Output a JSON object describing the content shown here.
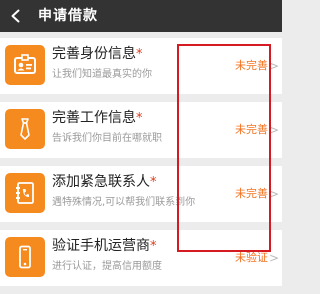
{
  "header": {
    "title": "申请借款",
    "back_icon": "chevron-left-icon"
  },
  "items": [
    {
      "label": "完善身份信息",
      "required_mark": "*",
      "subtitle": "让我们知道最真实的你",
      "status": "未完善",
      "icon": "id-card-icon"
    },
    {
      "label": "完善工作信息",
      "required_mark": "*",
      "subtitle": "告诉我们你目前在哪就职",
      "status": "未完善",
      "icon": "necktie-icon"
    },
    {
      "label": "添加紧急联系人",
      "required_mark": "*",
      "subtitle": "遇特殊情况,可以帮我们联系到你",
      "status": "未完善",
      "icon": "contact-book-icon"
    },
    {
      "label": "验证手机运营商",
      "required_mark": "*",
      "subtitle": "进行认证，提高信用额度",
      "status": "未验证",
      "icon": "mobile-phone-icon"
    }
  ],
  "colors": {
    "header_bg": "#333333",
    "accent": "#f58a1f",
    "status_text": "#f5721f",
    "required_star": "#e03a1b",
    "highlight_border": "#d51a22"
  }
}
